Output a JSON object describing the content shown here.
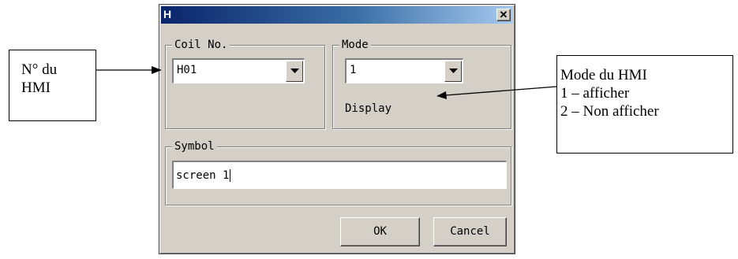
{
  "dialog": {
    "title": "H",
    "close_glyph": "✕",
    "coil_group": {
      "label": "Coil No.",
      "value": "H01"
    },
    "mode_group": {
      "label": "Mode",
      "value": "1",
      "description": "Display"
    },
    "symbol_group": {
      "label": "Symbol",
      "value": "screen 1"
    },
    "buttons": {
      "ok": "OK",
      "cancel": "Cancel"
    }
  },
  "annotations": {
    "left": {
      "line1": "N° du",
      "line2": "HMI"
    },
    "right": {
      "line1": "Mode du HMI",
      "line2": "1 – afficher",
      "line3": "2 – Non afficher"
    }
  },
  "icons": {
    "dropdown": "chevron-down-icon",
    "close": "close-icon",
    "arrow": "arrow-icon"
  }
}
